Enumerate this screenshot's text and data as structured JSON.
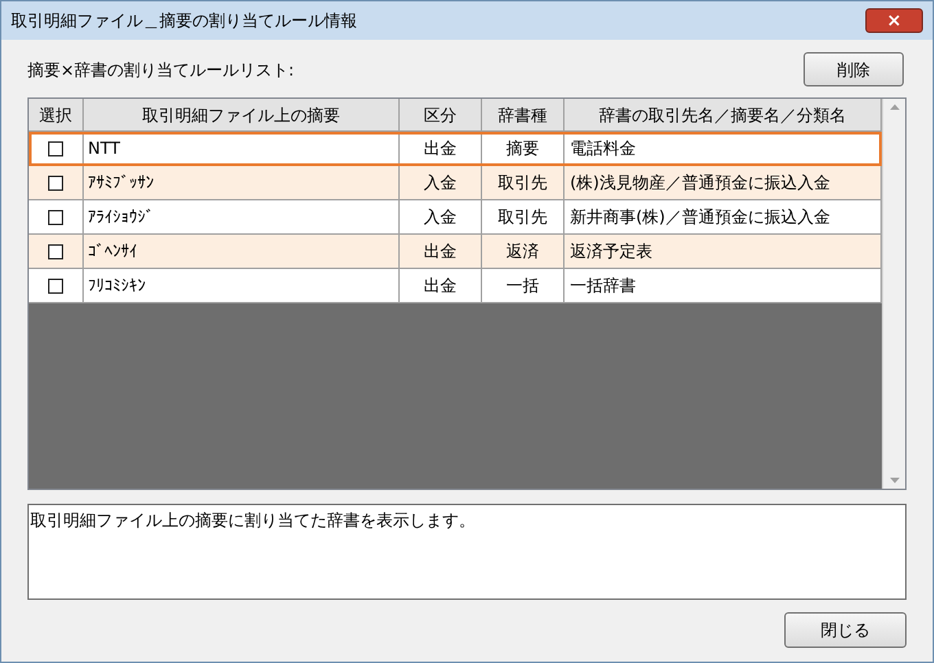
{
  "window": {
    "title": "取引明細ファイル＿摘要の割り当てルール情報",
    "close": "×"
  },
  "list_label": "摘要×辞書の割り当てルールリスト:",
  "delete_button": "削除",
  "table": {
    "columns": [
      "選択",
      "取引明細ファイル上の摘要",
      "区分",
      "辞書種",
      "辞書の取引先名／摘要名／分類名"
    ],
    "rows": [
      {
        "checked": false,
        "selected": true,
        "cells": [
          "",
          "NTT",
          "出金",
          "摘要",
          "電話料金"
        ]
      },
      {
        "checked": false,
        "selected": false,
        "cells": [
          "",
          "ｱｻﾐﾌﾞｯｻﾝ",
          "入金",
          "取引先",
          "(株)浅見物産／普通預金に振込入金"
        ]
      },
      {
        "checked": false,
        "selected": false,
        "cells": [
          "",
          "ｱﾗｲｼｮｳｼﾞ",
          "入金",
          "取引先",
          "新井商事(株)／普通預金に振込入金"
        ]
      },
      {
        "checked": false,
        "selected": false,
        "cells": [
          "",
          "ｺﾞﾍﾝｻｲ",
          "出金",
          "返済",
          "返済予定表"
        ]
      },
      {
        "checked": false,
        "selected": false,
        "cells": [
          "",
          "ﾌﾘｺﾐｼｷﾝ",
          "出金",
          "一括",
          "一括辞書"
        ]
      }
    ]
  },
  "description": "取引明細ファイル上の摘要に割り当てた辞書を表示します。",
  "close_button": "閉じる"
}
